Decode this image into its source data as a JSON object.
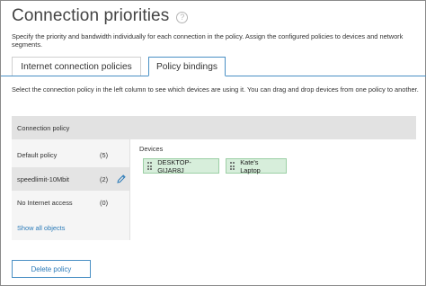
{
  "page": {
    "title": "Connection priorities",
    "help_icon": "question-mark",
    "intro": "Specify the priority and bandwidth individually for each connection in the policy. Assign the configured policies to devices and network segments."
  },
  "tabs": [
    {
      "label": "Internet connection policies",
      "active": false
    },
    {
      "label": "Policy bindings",
      "active": true
    }
  ],
  "description": "Select the connection policy in the left column to see which devices are using it. You can drag and drop devices from one policy to another.",
  "panel": {
    "header": "Connection policy",
    "policies": [
      {
        "name": "Default policy",
        "count": "(5)",
        "selected": false
      },
      {
        "name": "speedlimit-10Mbit",
        "count": "(2)",
        "selected": true
      },
      {
        "name": "No Internet access",
        "count": "(0)",
        "selected": false
      }
    ],
    "show_all": "Show all objects",
    "devices_label": "Devices",
    "devices": [
      {
        "name": "DESKTOP-GIJAR8J"
      },
      {
        "name": "Kate's Laptop"
      }
    ]
  },
  "actions": {
    "delete_label": "Delete policy"
  },
  "colors": {
    "accent": "#2a7ab8",
    "tab_border": "#4a90c4",
    "chip_bg": "#d7eedb",
    "chip_border": "#9ccfa5",
    "panel_header_bg": "#e2e2e2",
    "selected_row_bg": "#e4e4e4"
  }
}
